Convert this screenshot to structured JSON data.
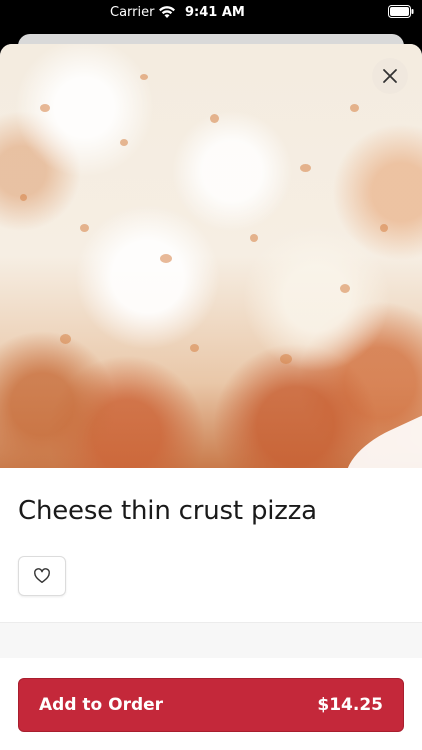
{
  "status_bar": {
    "carrier": "Carrier",
    "time": "9:41 AM"
  },
  "item": {
    "title": "Cheese thin crust pizza",
    "image_icon": "pizza-photo"
  },
  "actions": {
    "close_icon": "close-icon",
    "favorite_icon": "heart-icon"
  },
  "footer": {
    "add_label": "Add to Order",
    "price": "$14.25"
  },
  "colors": {
    "accent": "#c4283a",
    "background": "#ffffff"
  }
}
